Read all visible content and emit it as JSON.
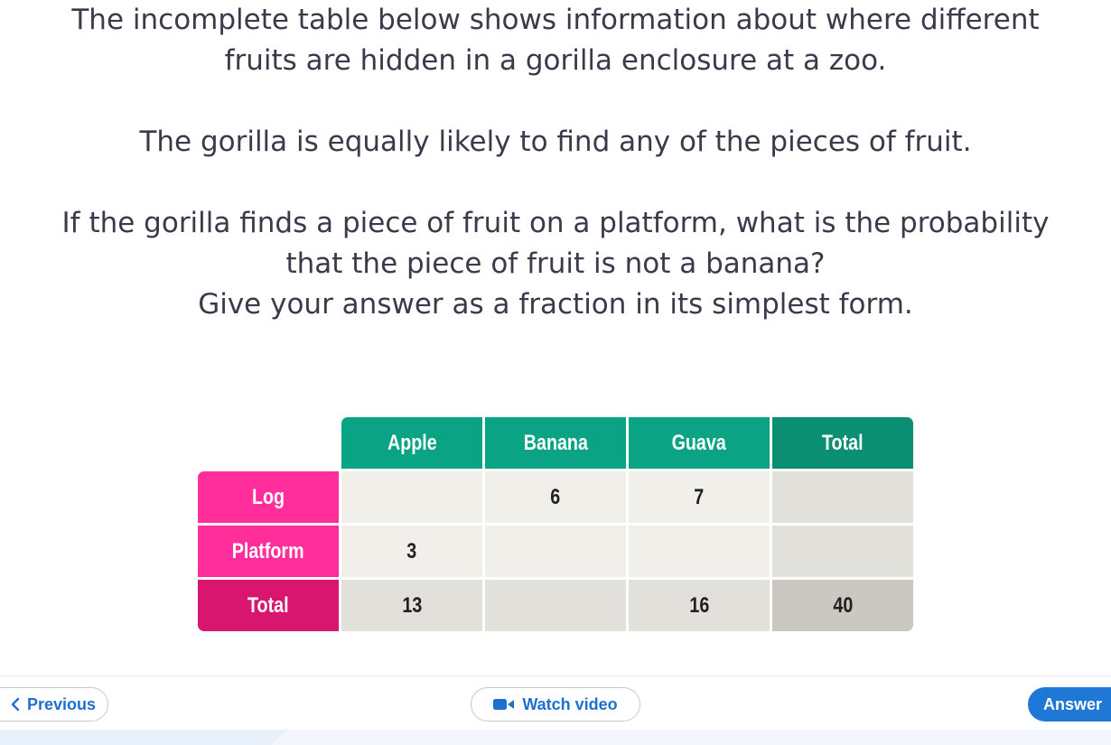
{
  "question": {
    "line1": "The incomplete table below shows information about where different",
    "line2": "fruits are hidden in a gorilla enclosure at a zoo.",
    "line3": "The gorilla is equally likely to find any of the pieces of fruit.",
    "line4": "If the gorilla finds a piece of fruit on a platform, what is the probability",
    "line5": "that the piece of fruit is not a banana?",
    "line6": "Give your answer as a fraction in its simplest form."
  },
  "table": {
    "columns": [
      "Apple",
      "Banana",
      "Guava",
      "Total"
    ],
    "rows": [
      {
        "label": "Log",
        "cells": [
          "",
          "6",
          "7",
          ""
        ]
      },
      {
        "label": "Platform",
        "cells": [
          "3",
          "",
          "",
          ""
        ]
      },
      {
        "label": "Total",
        "cells": [
          "13",
          "",
          "16",
          "40"
        ]
      }
    ]
  },
  "nav": {
    "previous_label": "Previous",
    "watch_video_label": "Watch video",
    "answer_label": "Answer"
  },
  "colors": {
    "header_green": "#0aa383",
    "row_pink": "#ff2e9a",
    "row_total_pink": "#d8166f",
    "accent_blue": "#1f78d6"
  },
  "icons": {
    "previous": "chevron-left-icon",
    "video": "video-camera-icon"
  }
}
